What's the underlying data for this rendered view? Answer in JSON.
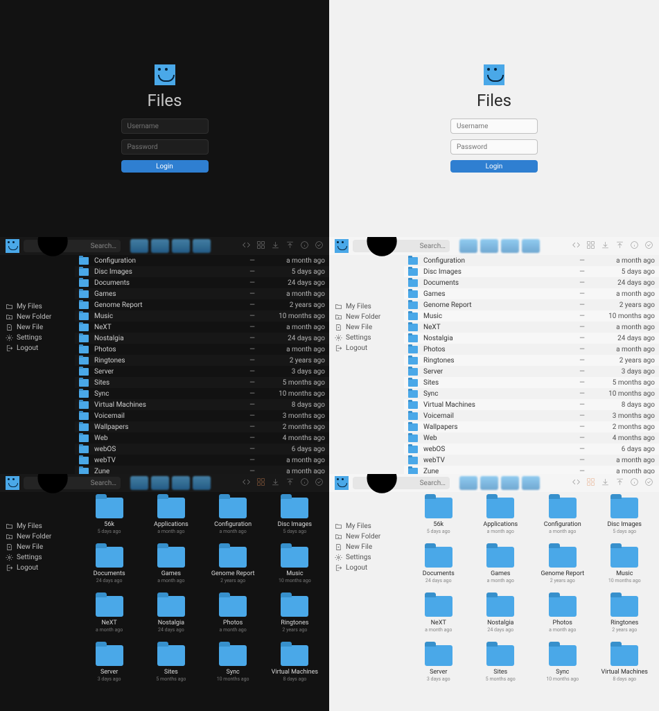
{
  "app_title": "Files",
  "login": {
    "username_placeholder": "Username",
    "password_placeholder": "Password",
    "login_label": "Login"
  },
  "search_placeholder": "Search…",
  "sidebar": {
    "items": [
      {
        "icon": "folder",
        "label": "My Files"
      },
      {
        "icon": "newfolder",
        "label": "New Folder"
      },
      {
        "icon": "newfile",
        "label": "New File"
      },
      {
        "icon": "settings",
        "label": "Settings"
      },
      {
        "icon": "logout",
        "label": "Logout"
      }
    ]
  },
  "list_rows": [
    {
      "name": "Configuration",
      "size": "—",
      "modified": "a month ago"
    },
    {
      "name": "Disc Images",
      "size": "—",
      "modified": "5 days ago"
    },
    {
      "name": "Documents",
      "size": "—",
      "modified": "24 days ago"
    },
    {
      "name": "Games",
      "size": "—",
      "modified": "a month ago"
    },
    {
      "name": "Genome Report",
      "size": "—",
      "modified": "2 years ago"
    },
    {
      "name": "Music",
      "size": "—",
      "modified": "10 months ago"
    },
    {
      "name": "NeXT",
      "size": "—",
      "modified": "a month ago"
    },
    {
      "name": "Nostalgia",
      "size": "—",
      "modified": "24 days ago"
    },
    {
      "name": "Photos",
      "size": "—",
      "modified": "a month ago"
    },
    {
      "name": "Ringtones",
      "size": "—",
      "modified": "2 years ago"
    },
    {
      "name": "Server",
      "size": "—",
      "modified": "3 days ago"
    },
    {
      "name": "Sites",
      "size": "—",
      "modified": "5 months ago"
    },
    {
      "name": "Sync",
      "size": "—",
      "modified": "10 months ago"
    },
    {
      "name": "Virtual Machines",
      "size": "—",
      "modified": "8 days ago"
    },
    {
      "name": "Voicemail",
      "size": "—",
      "modified": "3 months ago"
    },
    {
      "name": "Wallpapers",
      "size": "—",
      "modified": "2 months ago"
    },
    {
      "name": "Web",
      "size": "—",
      "modified": "4 months ago"
    },
    {
      "name": "webOS",
      "size": "—",
      "modified": "6 days ago"
    },
    {
      "name": "webTV",
      "size": "—",
      "modified": "a month ago"
    },
    {
      "name": "Zune",
      "size": "—",
      "modified": "a month ago"
    }
  ],
  "grid_cells": [
    {
      "name": "56k",
      "modified": "5 days ago"
    },
    {
      "name": "Applications",
      "modified": "a month ago"
    },
    {
      "name": "Configuration",
      "modified": "a month ago"
    },
    {
      "name": "Disc Images",
      "modified": "5 days ago"
    },
    {
      "name": "Documents",
      "modified": "24 days ago"
    },
    {
      "name": "Games",
      "modified": "a month ago"
    },
    {
      "name": "Genome Report",
      "modified": "2 years ago"
    },
    {
      "name": "Music",
      "modified": "10 months ago"
    },
    {
      "name": "NeXT",
      "modified": "a month ago"
    },
    {
      "name": "Nostalgia",
      "modified": "24 days ago"
    },
    {
      "name": "Photos",
      "modified": "a month ago"
    },
    {
      "name": "Ringtones",
      "modified": "2 years ago"
    },
    {
      "name": "Server",
      "modified": "3 days ago"
    },
    {
      "name": "Sites",
      "modified": "5 months ago"
    },
    {
      "name": "Sync",
      "modified": "10 months ago"
    },
    {
      "name": "Virtual Machines",
      "modified": "8 days ago"
    }
  ]
}
